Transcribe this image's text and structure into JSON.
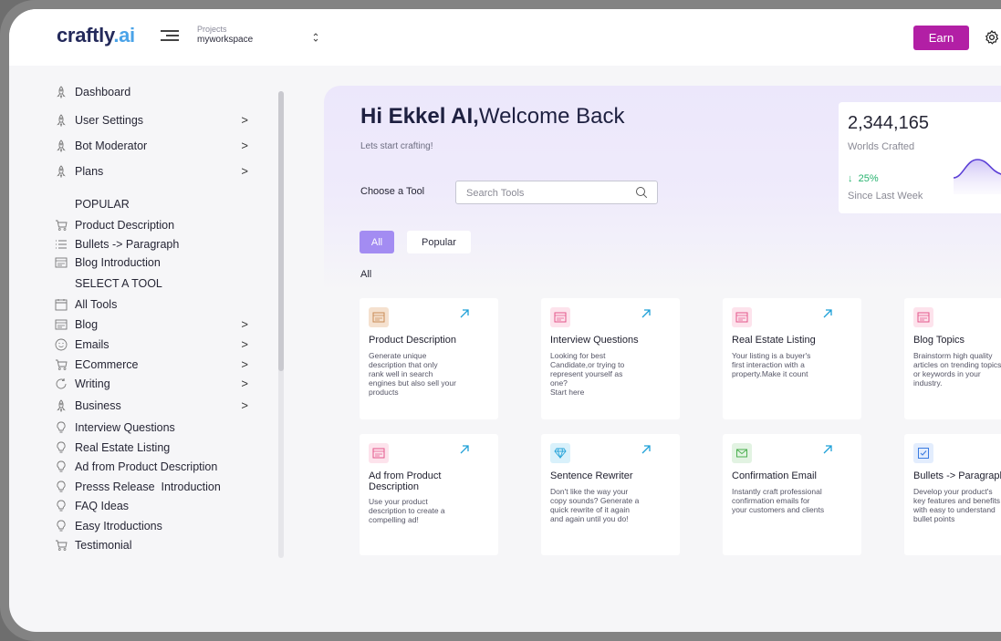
{
  "header": {
    "logo_main": "craftly",
    "logo_ai": ".ai",
    "project_label": "Projects",
    "project_name": "myworkspace",
    "earn_label": "Earn"
  },
  "sidebar": {
    "items": [
      {
        "label": "Dashboard",
        "icon": "rocket-icon"
      },
      {
        "label": "User Settings",
        "icon": "rocket-icon",
        "chevron": ">"
      },
      {
        "label": "Bot Moderator",
        "icon": "rocket-icon",
        "chevron": ">"
      },
      {
        "label": "Plans",
        "icon": "rocket-icon",
        "chevron": ">"
      }
    ],
    "popular_heading": "POPULAR",
    "popular_items": [
      {
        "label": "Product Description",
        "icon": "cart-icon"
      },
      {
        "label": "Bullets -> Paragraph",
        "icon": "list-icon"
      },
      {
        "label": "Blog Introduction",
        "icon": "blog-icon"
      }
    ],
    "tools_heading": "SELECT A TOOL",
    "tool_items": [
      {
        "label": "All Tools",
        "icon": "calendar-icon"
      },
      {
        "label": "Blog",
        "icon": "blog-icon",
        "chevron": ">"
      },
      {
        "label": "Emails",
        "icon": "smile-icon",
        "chevron": ">"
      },
      {
        "label": "ECommerce",
        "icon": "cart-icon",
        "chevron": ">"
      },
      {
        "label": "Writing",
        "icon": "refresh-icon",
        "chevron": ">"
      },
      {
        "label": "Business",
        "icon": "rocket-icon",
        "chevron": ">"
      },
      {
        "label": "Interview Questions",
        "icon": "bulb-icon"
      },
      {
        "label": "Real Estate Listing",
        "icon": "bulb-icon"
      },
      {
        "label": "Ad from Product Description",
        "icon": "bulb-icon"
      },
      {
        "label": "Presss Release  Introduction",
        "icon": "bulb-icon"
      },
      {
        "label": "FAQ Ideas",
        "icon": "bulb-icon"
      },
      {
        "label": "Easy Itroductions",
        "icon": "bulb-icon"
      },
      {
        "label": "Testimonial",
        "icon": "cart-icon"
      }
    ]
  },
  "main": {
    "greeting_name": "Hi Ekkel AI,",
    "greeting_rest": "Welcome Back",
    "subtitle": "Lets start crafting!",
    "choose_label": "Choose a Tool",
    "search_placeholder": "Search Tools",
    "tabs": [
      "All",
      "Popular"
    ],
    "filter_label": "All"
  },
  "stats": {
    "value": "2,344,165",
    "label": "Worlds Crafted",
    "change": "25%",
    "since": "Since Last Week",
    "line_color": "#5b3fd6"
  },
  "tools": [
    {
      "title": "Product Description",
      "desc": [
        "Generate unique",
        "description that only",
        "rank well in search",
        "engines but also sell your",
        "products"
      ],
      "icon_bg": "#f5e1cf",
      "icon_color": "#c98a55",
      "icon": "blog-icon"
    },
    {
      "title": "Interview Questions",
      "desc": [
        "Looking for best",
        "Candidate,or trying to",
        "represent yourself as",
        "one?",
        "Start here"
      ],
      "icon_bg": "#fde3ec",
      "icon_color": "#e4558a",
      "icon": "blog-icon"
    },
    {
      "title": "Real Estate Listing",
      "desc": [
        "Your listing is a buyer's",
        "first interaction with a",
        "property.Make it count"
      ],
      "icon_bg": "#fde3ec",
      "icon_color": "#e4558a",
      "icon": "blog-icon"
    },
    {
      "title": "Blog Topics",
      "desc": [
        "Brainstorm high quality",
        "articles on trending topics",
        "or keywords in your",
        "industry."
      ],
      "icon_bg": "#fde3ec",
      "icon_color": "#e4558a",
      "icon": "blog-icon"
    },
    {
      "title": "Ad from Product Description",
      "desc": [
        "Use your product",
        "description to create a",
        "compelling ad!"
      ],
      "icon_bg": "#fde3ec",
      "icon_color": "#e4558a",
      "icon": "blog-icon"
    },
    {
      "title": "Sentence Rewriter",
      "desc": [
        "Don't like the way your",
        "copy sounds? Generate a",
        "quick rewrite of it again",
        "and again until you do!"
      ],
      "icon_bg": "#d9f1fb",
      "icon_color": "#28a4d9",
      "icon": "diamond-icon"
    },
    {
      "title": "Confirmation Email",
      "desc": [
        "Instantly craft professional",
        "confirmation emails for",
        "your customers and clients"
      ],
      "icon_bg": "#e2f3e2",
      "icon_color": "#4caf50",
      "icon": "mail-icon"
    },
    {
      "title": "Bullets -> Paragraph",
      "desc": [
        "Develop your product's",
        "key features and benefits",
        "with easy to understand",
        "bullet points"
      ],
      "icon_bg": "#e3edfd",
      "icon_color": "#3a7be0",
      "icon": "checkbox-icon"
    }
  ]
}
